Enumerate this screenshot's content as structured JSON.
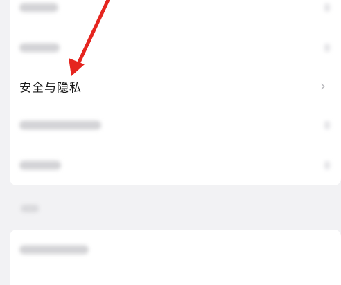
{
  "settings": {
    "highlighted_item": {
      "label": "安全与隐私",
      "chevron": "›"
    }
  },
  "annotation": {
    "arrow_color": "#e5251f"
  }
}
